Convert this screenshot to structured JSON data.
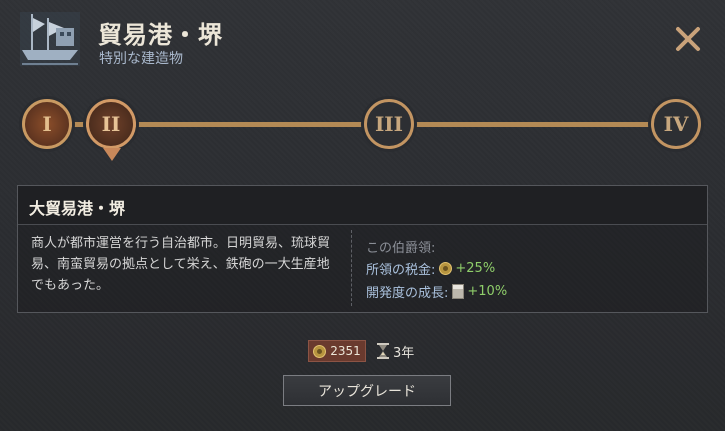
{
  "header": {
    "title": "貿易港・堺",
    "subtitle": "特別な建造物"
  },
  "levels": [
    {
      "label": "I",
      "state": "completed"
    },
    {
      "label": "II",
      "state": "current"
    },
    {
      "label": "III",
      "state": "locked"
    },
    {
      "label": "IV",
      "state": "locked"
    }
  ],
  "info": {
    "title": "大貿易港・堺",
    "description": "商人が都市運営を行う自治都市。日明貿易、琉球貿易、南蛮貿易の拠点として栄え、鉄砲の一大生産地でもあった。",
    "effects_heading": "この伯爵領:",
    "effects": [
      {
        "label": "所領の税金:",
        "icon": "gold-coin-icon",
        "value": "+25%"
      },
      {
        "label": "開発度の成長:",
        "icon": "development-tower-icon",
        "value": "+10%"
      }
    ]
  },
  "cost": {
    "gold": "2351",
    "time": "3年"
  },
  "buttons": {
    "upgrade": "アップグレード"
  },
  "colors": {
    "accent_bronze": "#c99a62",
    "effect_positive": "#8fce6a",
    "effect_label": "#a9c0dc",
    "cost_bg": "#6a3a2e"
  }
}
